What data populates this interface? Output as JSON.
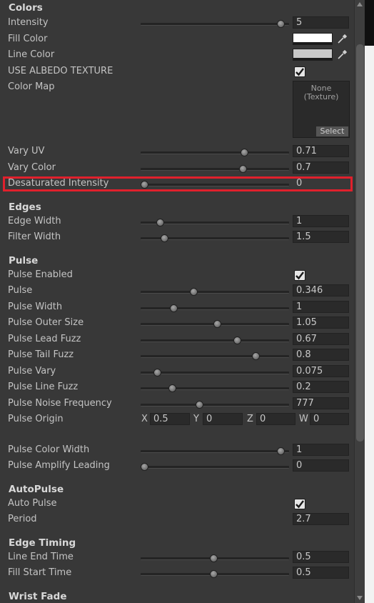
{
  "sections": {
    "colors": "Colors",
    "edges": "Edges",
    "pulse": "Pulse",
    "autopulse": "AutoPulse",
    "edge_timing": "Edge Timing",
    "wrist_fade": "Wrist Fade"
  },
  "rows": {
    "intensity": {
      "label": "Intensity",
      "value": "5",
      "slider": 0.97
    },
    "fill_color": {
      "label": "Fill Color",
      "color": "#ffffff"
    },
    "line_color": {
      "label": "Line Color",
      "color": "#c8c8c8"
    },
    "use_albedo": {
      "label": "USE ALBEDO TEXTURE",
      "checked": true
    },
    "color_map": {
      "label": "Color Map",
      "texture": "None\n(Texture)",
      "select": "Select"
    },
    "vary_uv": {
      "label": "Vary UV",
      "value": "0.71",
      "slider": 0.71
    },
    "vary_color": {
      "label": "Vary Color",
      "value": "0.7",
      "slider": 0.7
    },
    "desat": {
      "label": "Desaturated Intensity",
      "value": "0",
      "slider": 0.0
    },
    "edge_width": {
      "label": "Edge Width",
      "value": "1",
      "slider": 0.11
    },
    "filter_width": {
      "label": "Filter Width",
      "value": "1.5",
      "slider": 0.14
    },
    "pulse_enabled": {
      "label": "Pulse Enabled",
      "checked": true
    },
    "pulse": {
      "label": "Pulse",
      "value": "0.346",
      "slider": 0.35
    },
    "pulse_width": {
      "label": "Pulse Width",
      "value": "1",
      "slider": 0.21
    },
    "pulse_outer": {
      "label": "Pulse Outer Size",
      "value": "1.05",
      "slider": 0.52
    },
    "pulse_lead": {
      "label": "Pulse Lead Fuzz",
      "value": "0.67",
      "slider": 0.66
    },
    "pulse_tail": {
      "label": "Pulse Tail Fuzz",
      "value": "0.8",
      "slider": 0.79
    },
    "pulse_vary": {
      "label": "Pulse Vary",
      "value": "0.075",
      "slider": 0.09
    },
    "pulse_line_fuzz": {
      "label": "Pulse Line Fuzz",
      "value": "0.2",
      "slider": 0.2
    },
    "pulse_noise": {
      "label": "Pulse Noise Frequency",
      "value": "777",
      "slider": 0.39
    },
    "pulse_origin": {
      "label": "Pulse Origin",
      "x_label": "X",
      "x": "0.5",
      "y_label": "Y",
      "y": "0",
      "z_label": "Z",
      "z": "0",
      "w_label": "W",
      "w": "0"
    },
    "pulse_color_width": {
      "label": "Pulse Color Width",
      "value": "1",
      "slider": 0.97
    },
    "pulse_amplify": {
      "label": "Pulse Amplify Leading",
      "value": "0",
      "slider": 0.0
    },
    "auto_pulse": {
      "label": "Auto Pulse",
      "checked": true
    },
    "period": {
      "label": "Period",
      "value": "2.7"
    },
    "line_end": {
      "label": "Line End Time",
      "value": "0.5",
      "slider": 0.49
    },
    "fill_start": {
      "label": "Fill Start Time",
      "value": "0.5",
      "slider": 0.49
    }
  }
}
